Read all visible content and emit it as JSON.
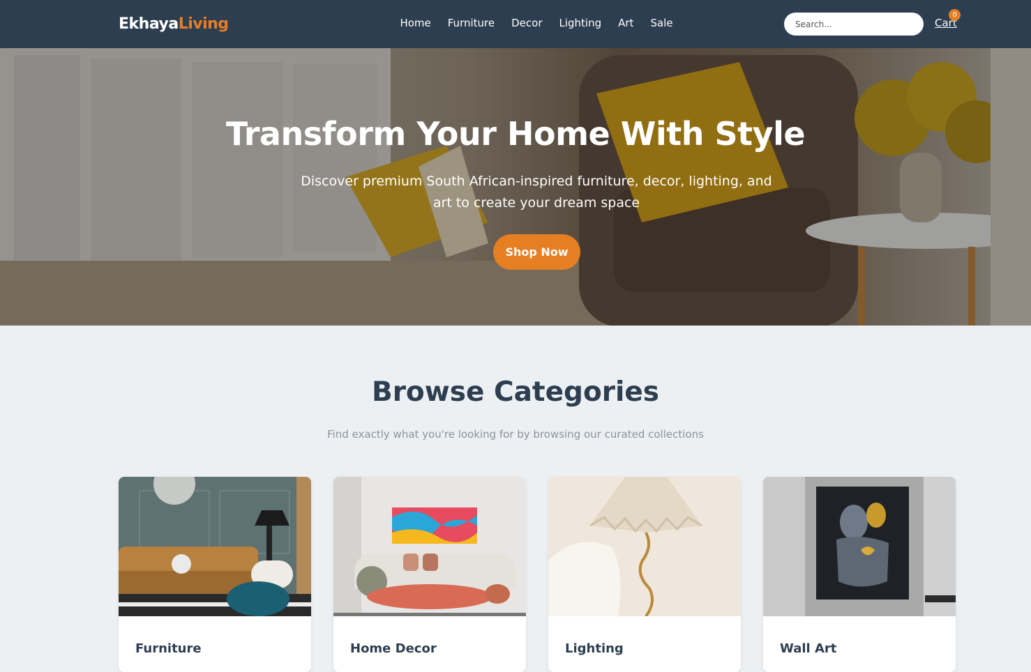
{
  "brand": {
    "part1": "Ekhaya",
    "part2": "Living"
  },
  "nav": {
    "items": [
      "Home",
      "Furniture",
      "Decor",
      "Lighting",
      "Art",
      "Sale"
    ]
  },
  "search": {
    "placeholder": "Search..."
  },
  "cart": {
    "label": "Cart",
    "count": "0"
  },
  "hero": {
    "title": "Transform Your Home With Style",
    "subtitle": "Discover premium South African-inspired furniture, decor, lighting, and art to create your dream space",
    "cta": "Shop Now"
  },
  "categories": {
    "title": "Browse Categories",
    "subtitle": "Find exactly what you're looking for by browsing our curated collections",
    "items": [
      {
        "name": "Furniture",
        "icon": "sofa-image"
      },
      {
        "name": "Home Decor",
        "icon": "living-room-image"
      },
      {
        "name": "Lighting",
        "icon": "lamp-image"
      },
      {
        "name": "Wall Art",
        "icon": "sculpture-art-image"
      }
    ]
  },
  "colors": {
    "navbar": "#2c3e50",
    "accent": "#e67e22",
    "background": "#edf0f2"
  }
}
